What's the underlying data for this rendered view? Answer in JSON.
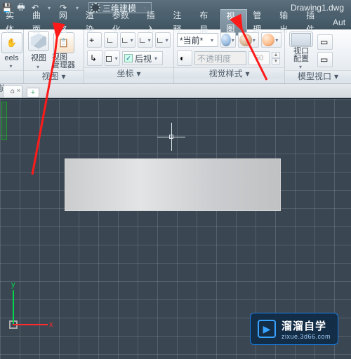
{
  "qat": {
    "workspace_label": "三维建模",
    "doc_title": "Drawing1.dwg"
  },
  "menus": [
    "实体",
    "曲面",
    "网格",
    "渲染",
    "参数化",
    "插入",
    "注释",
    "布局",
    "视图",
    "管理",
    "输出",
    "插件",
    "Aut"
  ],
  "active_menu_index": 8,
  "panels": {
    "eels": {
      "big_label": "eels",
      "panel_label": ""
    },
    "view": {
      "big1": "视图",
      "big2": "视图\n管理器",
      "panel_label": "视图"
    },
    "coord": {
      "back": "后视",
      "panel_label": "坐标"
    },
    "visual": {
      "combo_current": "*当前*",
      "opacity_label": "不透明度",
      "opacity_value": "60",
      "panel_label": "视觉样式"
    },
    "viewport": {
      "big1": "视口\n配置",
      "panel_label": "模型视口"
    }
  },
  "nav_left": "航",
  "tabs": {
    "plus": "+"
  },
  "ucs": {
    "x": "x",
    "y": "y"
  },
  "watermark": {
    "title": "溜溜自学",
    "sub": "zixue.3d66.com"
  }
}
